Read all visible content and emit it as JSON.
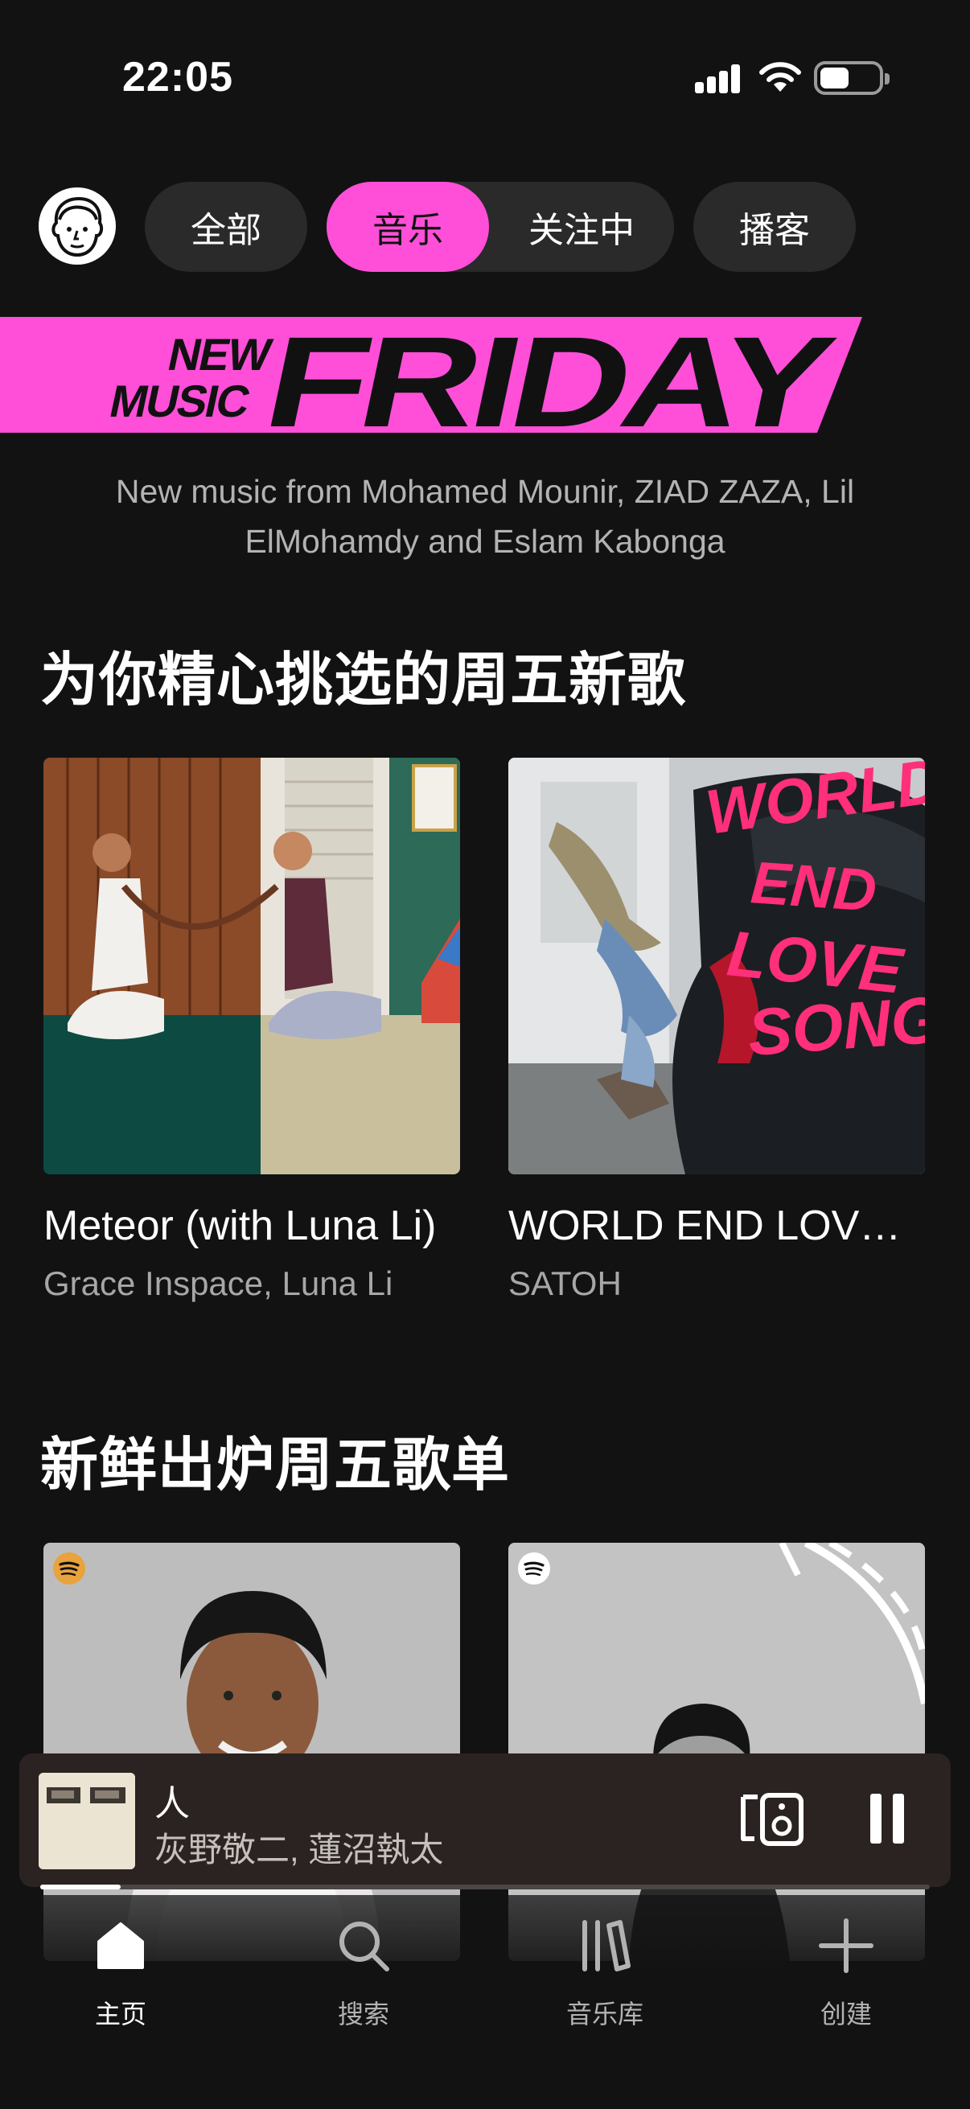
{
  "status_bar": {
    "time": "22:05",
    "battery_level": 0.45
  },
  "chips": {
    "all": "全部",
    "music": "音乐",
    "following": "关注中",
    "podcasts": "播客",
    "selected": "音乐"
  },
  "banner": {
    "word_new": "NEW",
    "word_music": "MUSIC",
    "word_friday": "FRIDAY",
    "description": "New music from Mohamed Mounir, ZIAD ZAZA, Lil ElMohamdy and Eslam Kabonga",
    "accent_color": "#ff4fd8"
  },
  "section1": {
    "title": "为你精心挑选的周五新歌",
    "items": [
      {
        "title": "Meteor (with Luna Li)",
        "subtitle": "Grace Inspace, Luna Li"
      },
      {
        "title": "WORLD END LOVE SONG",
        "subtitle": "SATOH",
        "art_text": [
          "WORLD",
          "END",
          "LOVE",
          "SONG"
        ]
      }
    ]
  },
  "section2": {
    "title": "新鲜出炉周五歌单",
    "items": [
      {
        "logo_icon": "spotify-icon"
      },
      {
        "logo_icon": "spotify-icon"
      }
    ]
  },
  "mini_player": {
    "title": "人",
    "artist": "灰野敬二, 蓮沼執太",
    "progress": 0.09
  },
  "nav": {
    "items": [
      {
        "label": "主页",
        "icon": "home-icon",
        "active": true
      },
      {
        "label": "搜索",
        "icon": "search-icon",
        "active": false
      },
      {
        "label": "音乐库",
        "icon": "library-icon",
        "active": false
      },
      {
        "label": "创建",
        "icon": "plus-icon",
        "active": false
      }
    ]
  }
}
